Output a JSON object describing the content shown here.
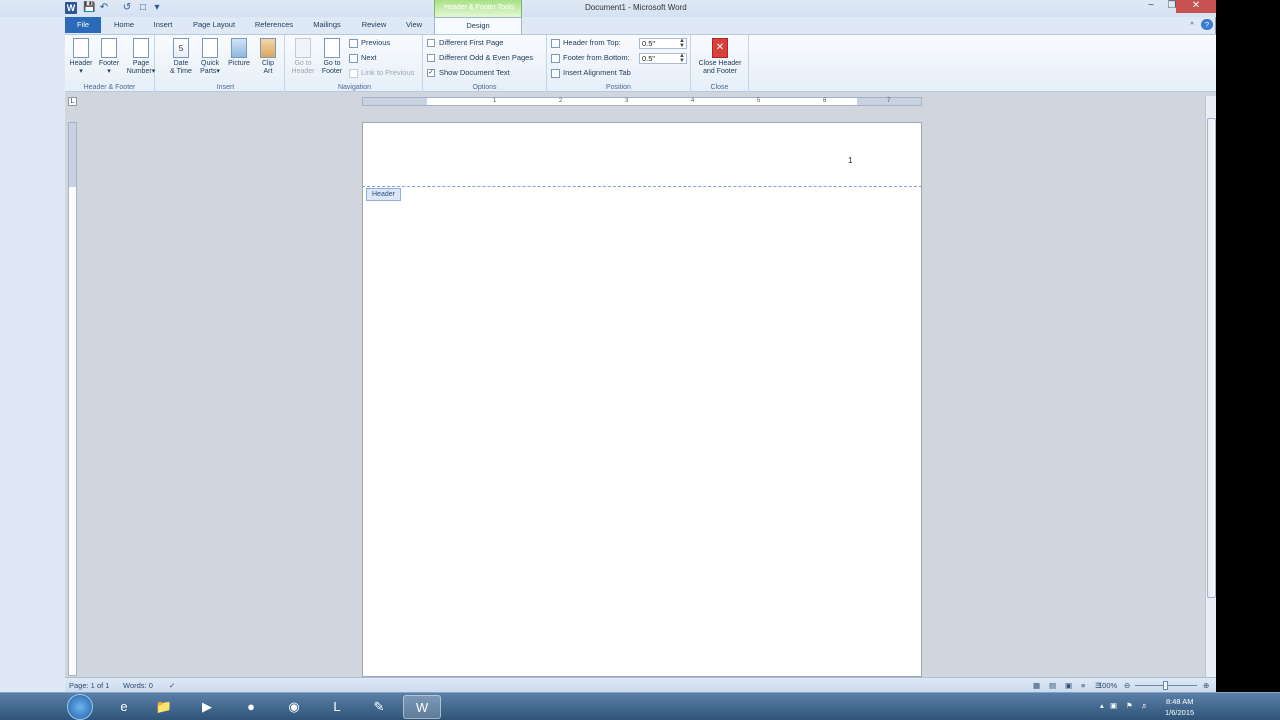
{
  "window": {
    "title": "Document1 - Microsoft Word",
    "minimize": "−",
    "restore": "❐",
    "close": "✕"
  },
  "contextual": {
    "group": "Header & Footer Tools"
  },
  "tabs": [
    "File",
    "Home",
    "Insert",
    "Page Layout",
    "References",
    "Mailings",
    "Review",
    "View",
    "Design"
  ],
  "ribbon": {
    "header_footer": {
      "label": "Header & Footer",
      "header": "Header",
      "footer": "Footer",
      "page_number_1": "Page",
      "page_number_2": "Number"
    },
    "insert": {
      "label": "Insert",
      "date_1": "Date",
      "date_2": "& Time",
      "qp_1": "Quick",
      "qp_2": "Parts",
      "picture": "Picture",
      "clip_1": "Clip",
      "clip_2": "Art"
    },
    "navigation": {
      "label": "Navigation",
      "gh_1": "Go to",
      "gh_2": "Header",
      "gf_1": "Go to",
      "gf_2": "Footer",
      "previous": "Previous",
      "next": "Next",
      "link": "Link to Previous"
    },
    "options": {
      "label": "Options",
      "first": "Different First Page",
      "oddeven": "Different Odd & Even Pages",
      "show": "Show Document Text",
      "show_checked": true
    },
    "position": {
      "label": "Position",
      "hft": "Header from Top:",
      "hft_val": "0.5\"",
      "ffb": "Footer from Bottom:",
      "ffb_val": "0.5\"",
      "align": "Insert Alignment Tab"
    },
    "close": {
      "label": "Close",
      "btn_1": "Close Header",
      "btn_2": "and Footer"
    }
  },
  "ruler": [
    "1",
    "2",
    "3",
    "4",
    "5",
    "6",
    "7"
  ],
  "document": {
    "header_tag": "Header",
    "page_number": "1"
  },
  "status": {
    "page": "Page: 1 of 1",
    "words": "Words: 0",
    "zoom": "100%",
    "zoom_level": 1.0
  },
  "tray": {
    "time": "8:48 AM",
    "date": "1/6/2015"
  },
  "colors": {
    "file_tab": "#2a6ab8",
    "context_green": "#a8e084",
    "close_red": "#d9403a"
  }
}
